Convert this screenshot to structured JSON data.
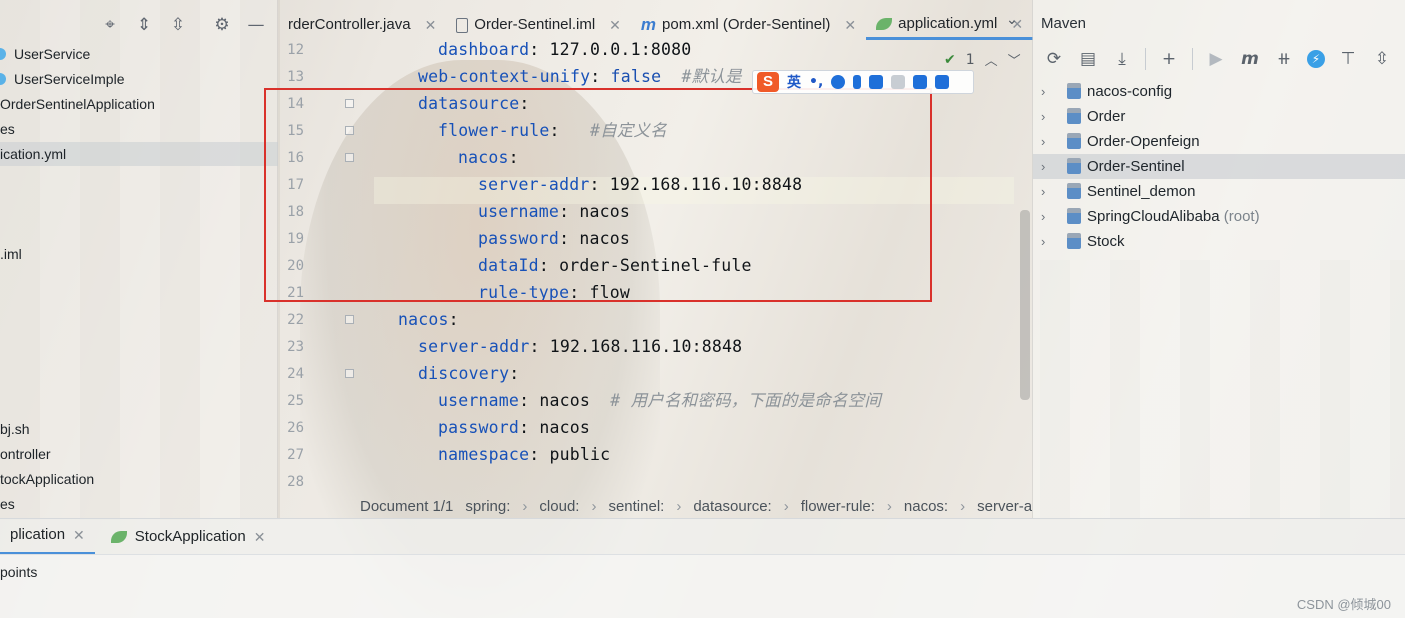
{
  "project_tree": {
    "toolbar_icons": [
      "crosshair-icon",
      "expand-all-icon",
      "collapse-all-icon",
      "gear-icon",
      "minimize-icon"
    ],
    "items": [
      {
        "label": "UserService",
        "class_icon": true
      },
      {
        "label": "UserServiceImple",
        "class_icon": true
      },
      {
        "label": "OrderSentinelApplication",
        "class_icon": false
      },
      {
        "label": "es",
        "class_icon": false
      },
      {
        "label": "ication.yml",
        "class_icon": false,
        "selected": true
      },
      {
        "label": ".iml",
        "class_icon": false
      },
      {
        "label": "bj.sh",
        "class_icon": false
      },
      {
        "label": "ontroller",
        "class_icon": false
      },
      {
        "label": "tockApplication",
        "class_icon": false
      },
      {
        "label": "es",
        "class_icon": false
      }
    ]
  },
  "editor_tabs": [
    {
      "label": "rderController.java",
      "icon": "none"
    },
    {
      "label": "Order-Sentinel.iml",
      "icon": "file-icon"
    },
    {
      "label": "pom.xml (Order-Sentinel)",
      "icon": "maven-m-icon"
    },
    {
      "label": "application.yml",
      "icon": "spring-leaf-icon",
      "active": true
    }
  ],
  "inspection": {
    "count": "1"
  },
  "code": {
    "lines": [
      {
        "num": "12",
        "key": "dashboard",
        "value": " 127.0.0.1:8080",
        "comment": ""
      },
      {
        "num": "13",
        "key": "web-context-unify",
        "value": " false",
        "comment": "  #默认是"
      },
      {
        "num": "14",
        "key": "datasource",
        "value": "",
        "comment": ""
      },
      {
        "num": "15",
        "key": "flower-rule",
        "value": "",
        "comment": "   #自定义名"
      },
      {
        "num": "16",
        "key": "nacos",
        "value": "",
        "comment": ""
      },
      {
        "num": "17",
        "key": "server-addr",
        "value": " 192.168.116.10:8848",
        "comment": ""
      },
      {
        "num": "18",
        "key": "username",
        "value": " nacos",
        "comment": ""
      },
      {
        "num": "19",
        "key": "password",
        "value": " nacos",
        "comment": ""
      },
      {
        "num": "20",
        "key": "dataId",
        "value": " order-Sentinel-fule",
        "comment": ""
      },
      {
        "num": "21",
        "key": "rule-type",
        "value": " flow",
        "comment": ""
      },
      {
        "num": "22",
        "key": "nacos",
        "value": "",
        "comment": ""
      },
      {
        "num": "23",
        "key": "server-addr",
        "value": " 192.168.116.10:8848",
        "comment": ""
      },
      {
        "num": "24",
        "key": "discovery",
        "value": "",
        "comment": ""
      },
      {
        "num": "25",
        "key": "username",
        "value": " nacos",
        "comment": "  # 用户名和密码，下面的是命名空间"
      },
      {
        "num": "26",
        "key": "password",
        "value": " nacos",
        "comment": ""
      },
      {
        "num": "27",
        "key": "namespace",
        "value": " public",
        "comment": ""
      },
      {
        "num": "28",
        "key": "",
        "value": "",
        "comment": ""
      }
    ]
  },
  "ime_toolbar": {
    "logo": "S",
    "mode": "英",
    "punct": "•,"
  },
  "breadcrumb": {
    "document": "Document 1/1",
    "path": [
      "spring:",
      "cloud:",
      "sentinel:",
      "datasource:",
      "flower-rule:",
      "nacos:",
      "server-add"
    ]
  },
  "maven": {
    "title": "Maven",
    "projects": [
      {
        "label": "nacos-config",
        "suffix": ""
      },
      {
        "label": "Order",
        "suffix": ""
      },
      {
        "label": "Order-Openfeign",
        "suffix": ""
      },
      {
        "label": "Order-Sentinel",
        "suffix": "",
        "selected": true
      },
      {
        "label": "Sentinel_demon",
        "suffix": ""
      },
      {
        "label": "SpringCloudAlibaba",
        "suffix": " (root)"
      },
      {
        "label": "Stock",
        "suffix": ""
      }
    ]
  },
  "bottom": {
    "tabs": [
      {
        "label": "plication",
        "active": true
      },
      {
        "label": "StockApplication",
        "active": false
      }
    ],
    "panel_label": "points"
  },
  "watermark": "CSDN @倾城00",
  "colors": {
    "accent": "#4a90d9",
    "key": "#1751b8",
    "highlight_box": "#d9312b",
    "comment": "#8c9399"
  }
}
